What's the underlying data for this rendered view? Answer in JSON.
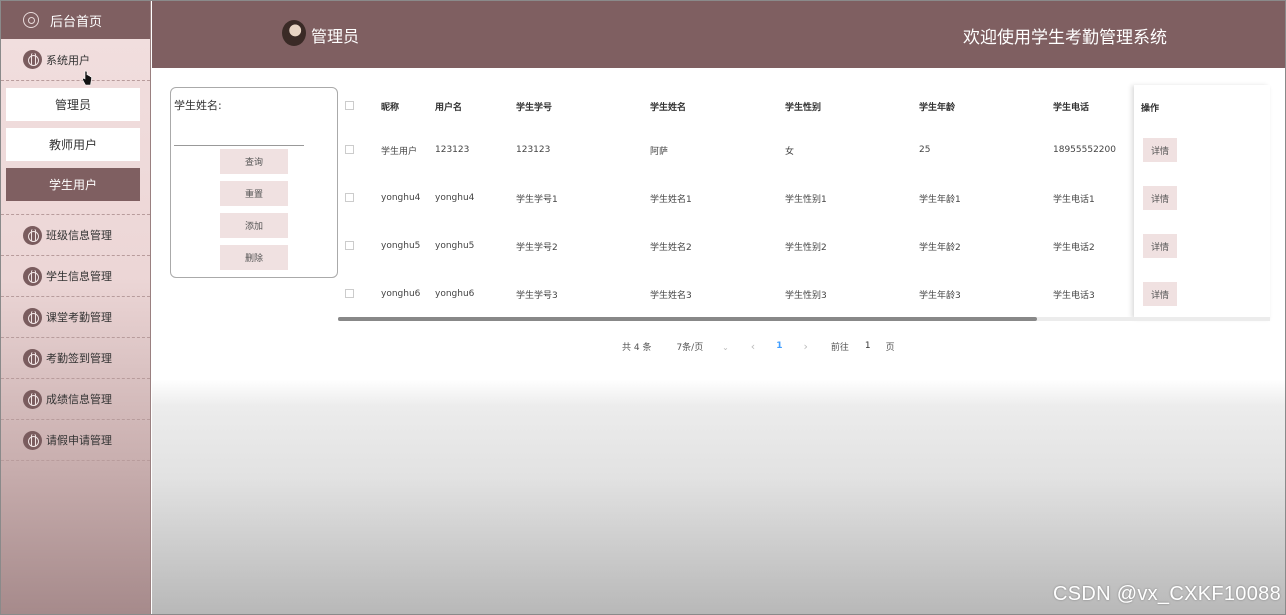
{
  "sidebar": {
    "home": "后台首页",
    "system_users": "系统用户",
    "sub_items": [
      {
        "label": "管理员",
        "active": false
      },
      {
        "label": "教师用户",
        "active": false
      },
      {
        "label": "学生用户",
        "active": true
      }
    ],
    "items": [
      "班级信息管理",
      "学生信息管理",
      "课堂考勤管理",
      "考勤签到管理",
      "成绩信息管理",
      "请假申请管理"
    ]
  },
  "header": {
    "role": "管理员",
    "welcome": "欢迎使用学生考勤管理系统"
  },
  "search": {
    "label": "学生姓名:",
    "value": "",
    "buttons": [
      "查询",
      "重置",
      "添加",
      "删除"
    ]
  },
  "table": {
    "columns": [
      "昵称",
      "用户名",
      "学生学号",
      "学生姓名",
      "学生性别",
      "学生年龄",
      "学生电话",
      "操作"
    ],
    "rows": [
      [
        "学生用户",
        "123123",
        "123123",
        "阿萨",
        "女",
        "25",
        "18955552200"
      ],
      [
        "yonghu4",
        "yonghu4",
        "学生学号1",
        "学生姓名1",
        "学生性别1",
        "学生年龄1",
        "学生电话1"
      ],
      [
        "yonghu5",
        "yonghu5",
        "学生学号2",
        "学生姓名2",
        "学生性别2",
        "学生年龄2",
        "学生电话2"
      ],
      [
        "yonghu6",
        "yonghu6",
        "学生学号3",
        "学生姓名3",
        "学生性别3",
        "学生年龄3",
        "学生电话3"
      ]
    ],
    "detail_label": "详情",
    "scroll_fraction": 0.75
  },
  "pager": {
    "total": "共 4 条",
    "page_size": "7条/页",
    "current": "1",
    "goto_label": "前往",
    "goto_value": "1",
    "page_suffix": "页"
  },
  "icons": {
    "home": "home-icon",
    "menu": "flower-icon",
    "prev": "chevron-left-icon",
    "next": "chevron-right-icon",
    "dropdown": "chevron-down-icon"
  },
  "colors": {
    "accent": "#7f5f61",
    "light": "#f0e1e1",
    "pager_active": "#409eff"
  },
  "watermark": "CSDN @vx_CXKF10088"
}
